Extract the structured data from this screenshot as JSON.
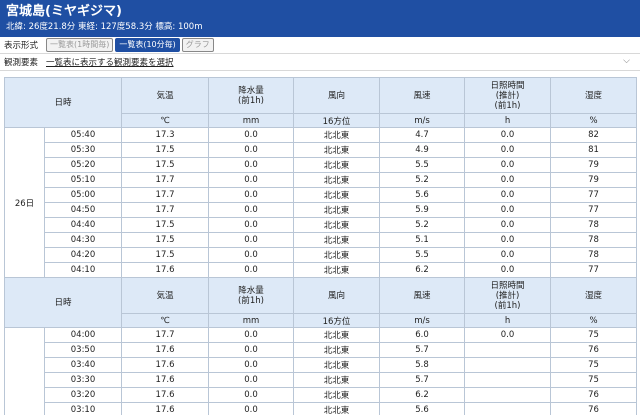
{
  "station": {
    "title": "宮城島(ミヤギジマ)",
    "coords": "北緯: 26度21.8分 東経: 127度58.3分 標高: 100m"
  },
  "controls": {
    "format_label": "表示形式",
    "buttons": [
      "一覧表(1時間毎)",
      "一覧表(10分毎)",
      "グラフ"
    ],
    "element_label": "観測要素",
    "element_select": "一覧表に表示する観測要素を選択"
  },
  "table": {
    "headers": [
      "日時",
      "気温",
      "降水量\n(前1h)",
      "風向",
      "風速",
      "日照時間\n(推計)\n(前1h)",
      "湿度"
    ],
    "units": [
      "℃",
      "mm",
      "16方位",
      "m/s",
      "h",
      "%"
    ],
    "day": "26日",
    "block1": [
      [
        "05:40",
        "17.3",
        "0.0",
        "北北東",
        "4.7",
        "0.0",
        "82"
      ],
      [
        "05:30",
        "17.5",
        "0.0",
        "北北東",
        "4.9",
        "0.0",
        "81"
      ],
      [
        "05:20",
        "17.5",
        "0.0",
        "北北東",
        "5.5",
        "0.0",
        "79"
      ],
      [
        "05:10",
        "17.7",
        "0.0",
        "北北東",
        "5.2",
        "0.0",
        "79"
      ],
      [
        "05:00",
        "17.7",
        "0.0",
        "北北東",
        "5.6",
        "0.0",
        "77"
      ],
      [
        "04:50",
        "17.7",
        "0.0",
        "北北東",
        "5.9",
        "0.0",
        "77"
      ],
      [
        "04:40",
        "17.5",
        "0.0",
        "北北東",
        "5.2",
        "0.0",
        "78"
      ],
      [
        "04:30",
        "17.5",
        "0.0",
        "北北東",
        "5.1",
        "0.0",
        "78"
      ],
      [
        "04:20",
        "17.5",
        "0.0",
        "北北東",
        "5.5",
        "0.0",
        "78"
      ],
      [
        "04:10",
        "17.6",
        "0.0",
        "北北東",
        "6.2",
        "0.0",
        "77"
      ]
    ],
    "block2": [
      [
        "04:00",
        "17.7",
        "0.0",
        "北北東",
        "6.0",
        "0.0",
        "75"
      ],
      [
        "03:50",
        "17.6",
        "0.0",
        "北北東",
        "5.7",
        "",
        "76"
      ],
      [
        "03:40",
        "17.6",
        "0.0",
        "北北東",
        "5.8",
        "",
        "75"
      ],
      [
        "03:30",
        "17.6",
        "0.0",
        "北北東",
        "5.7",
        "",
        "75"
      ],
      [
        "03:20",
        "17.6",
        "0.0",
        "北北東",
        "6.2",
        "",
        "76"
      ],
      [
        "03:10",
        "17.6",
        "0.0",
        "北北東",
        "5.6",
        "",
        "76"
      ]
    ]
  }
}
